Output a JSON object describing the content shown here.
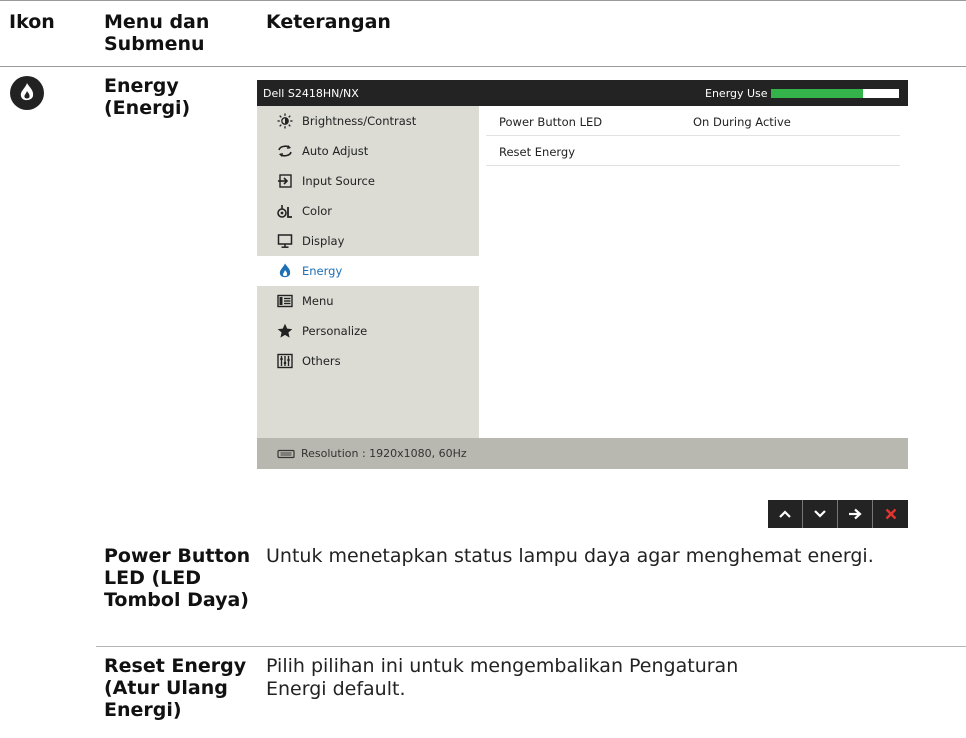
{
  "header": {
    "icon_col": "Ikon",
    "menu_col": "Menu dan Submenu",
    "desc_col": "Keterangan"
  },
  "energy_section": {
    "icon": "energy-icon",
    "name": "Energy (Energi)"
  },
  "osd": {
    "title": "Dell S2418HN/NX",
    "energy_use_label": "Energy Use",
    "energy_use_level": 0.72,
    "energy_bar_color": "#34b34a",
    "menu_items": [
      {
        "label": "Brightness/Contrast",
        "icon": "sun-icon",
        "active": false
      },
      {
        "label": "Auto Adjust",
        "icon": "arrows-cycle-icon",
        "active": false
      },
      {
        "label": "Input Source",
        "icon": "input-arrow-icon",
        "active": false
      },
      {
        "label": "Color",
        "icon": "color-icon",
        "active": false
      },
      {
        "label": "Display",
        "icon": "monitor-icon",
        "active": false
      },
      {
        "label": "Energy",
        "icon": "energy-icon",
        "active": true
      },
      {
        "label": "Menu",
        "icon": "menu-icon",
        "active": false
      },
      {
        "label": "Personalize",
        "icon": "star-icon",
        "active": false
      },
      {
        "label": "Others",
        "icon": "others-icon",
        "active": false
      }
    ],
    "settings": [
      {
        "label": "Power Button LED",
        "value": "On During Active"
      },
      {
        "label": "Reset Energy",
        "value": ""
      }
    ],
    "resolution": "Resolution : 1920x1080, 60Hz",
    "accent_color": "#1f6fb5"
  },
  "nav_buttons": [
    {
      "icon": "chevron-up-icon",
      "glyph": "^"
    },
    {
      "icon": "chevron-down-icon",
      "glyph": "v"
    },
    {
      "icon": "arrow-right-icon",
      "glyph": "→"
    },
    {
      "icon": "close-icon",
      "glyph": "✕"
    }
  ],
  "rows": [
    {
      "name": "Power Button LED (LED Tombol Daya)",
      "desc": "Untuk menetapkan status lampu daya agar menghemat energi."
    },
    {
      "name": "Reset Energy (Atur Ulang Energi)",
      "desc": "Pilih pilihan ini untuk mengembalikan Pengaturan Energi default."
    }
  ]
}
